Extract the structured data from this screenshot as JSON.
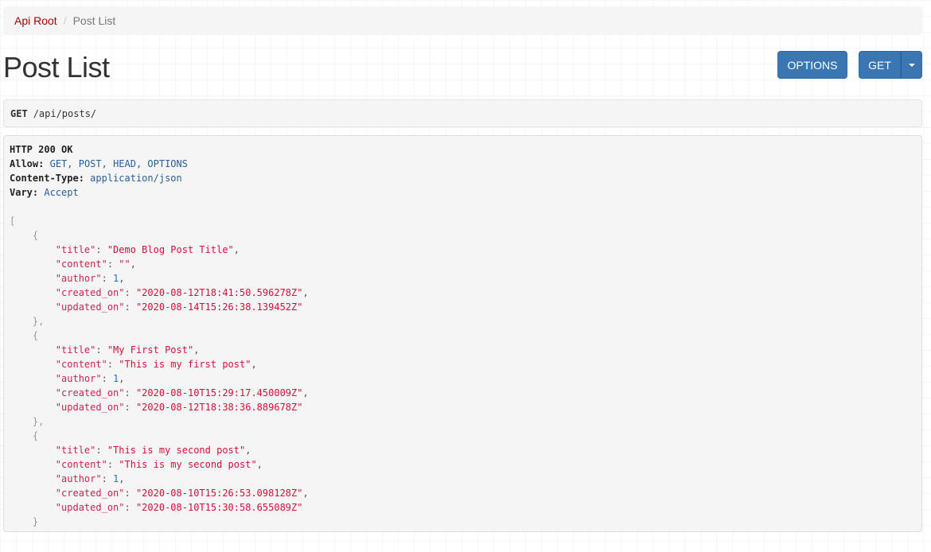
{
  "breadcrumb": {
    "root": "Api Root",
    "separator": "/",
    "current": "Post List"
  },
  "page_title": "Post List",
  "buttons": {
    "options": "OPTIONS",
    "get": "GET"
  },
  "request": {
    "method": "GET",
    "path": "/api/posts/"
  },
  "response": {
    "status": "HTTP 200 OK",
    "headers": [
      {
        "key": "Allow:",
        "value": "GET, POST, HEAD, OPTIONS"
      },
      {
        "key": "Content-Type:",
        "value": "application/json"
      },
      {
        "key": "Vary:",
        "value": "Accept"
      }
    ],
    "posts": [
      {
        "title": "\"Demo Blog Post Title\"",
        "content": "\"\"",
        "author": "1",
        "created_on": "\"2020-08-12T18:41:50.596278Z\"",
        "updated_on": "\"2020-08-14T15:26:38.139452Z\""
      },
      {
        "title": "\"My First Post\"",
        "content": "\"This is my first post\"",
        "author": "1",
        "created_on": "\"2020-08-10T15:29:17.450009Z\"",
        "updated_on": "\"2020-08-12T18:38:36.889678Z\""
      },
      {
        "title": "\"This is my second post\"",
        "content": "\"This is my second post\"",
        "author": "1",
        "created_on": "\"2020-08-10T15:26:53.098128Z\"",
        "updated_on": "\"2020-08-10T15:30:58.655089Z\""
      }
    ],
    "keys": {
      "title": "\"title\"",
      "content": "\"content\"",
      "author": "\"author\"",
      "created_on": "\"created_on\"",
      "updated_on": "\"updated_on\""
    }
  },
  "colors": {
    "breadcrumb_link": "#a30000",
    "button": "#3a76b2",
    "json_string": "#d0103a",
    "json_number": "#1f6fc5",
    "header_value": "#265e9c"
  }
}
